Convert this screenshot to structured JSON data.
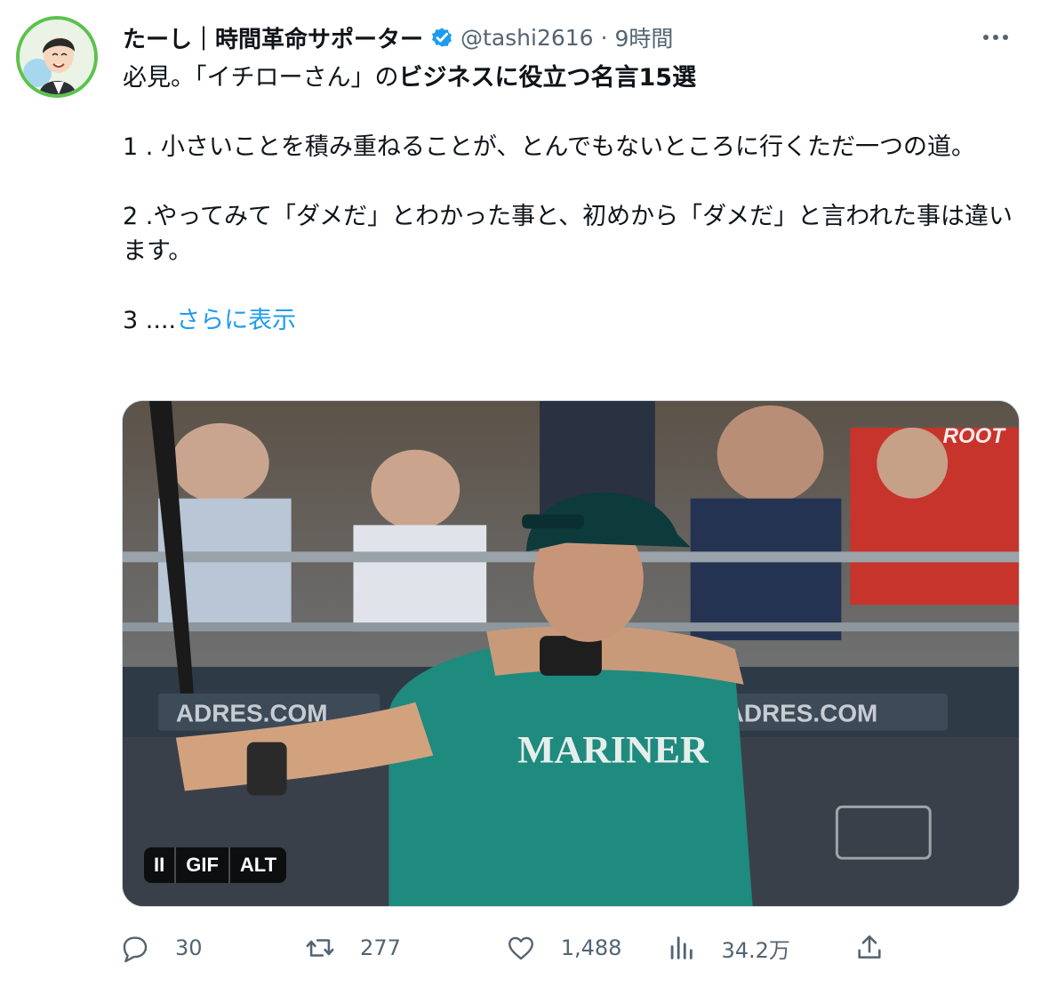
{
  "user": {
    "display_name": "たーし｜時間革命サポーター",
    "handle": "@tashi2616",
    "separator": "·",
    "time": "9時間"
  },
  "tweet": {
    "intro_plain": "必見。「イチローさん」の",
    "intro_bold": "ビジネスに役立つ名言15選",
    "line1": "1 . 小さいことを積み重ねることが、とんでもないところに行くただ一つの道。",
    "line2": "2 .やってみて「ダメだ」とわかった事と、初めから「ダメだ」と言われた事は違います。",
    "line3_prefix": "3 ....",
    "show_more": "さらに表示"
  },
  "media": {
    "badges": {
      "pause": "II",
      "gif": "GIF",
      "alt": "ALT"
    },
    "jersey_text": "MARINER",
    "watermark": "ROOT",
    "banner_left": "ADRES.COM",
    "banner_right": "ADRES.COM"
  },
  "actions": {
    "reply_count": "30",
    "retweet_count": "277",
    "like_count": "1,488",
    "views_count": "34.2万"
  },
  "colors": {
    "link": "#1d9bf0",
    "secondary": "#536471",
    "verified": "#1d9bf0",
    "avatar_ring": "#5cc24d"
  },
  "icons": [
    "more-icon",
    "verified-badge-icon",
    "reply-icon",
    "retweet-icon",
    "like-icon",
    "views-icon",
    "share-icon"
  ]
}
